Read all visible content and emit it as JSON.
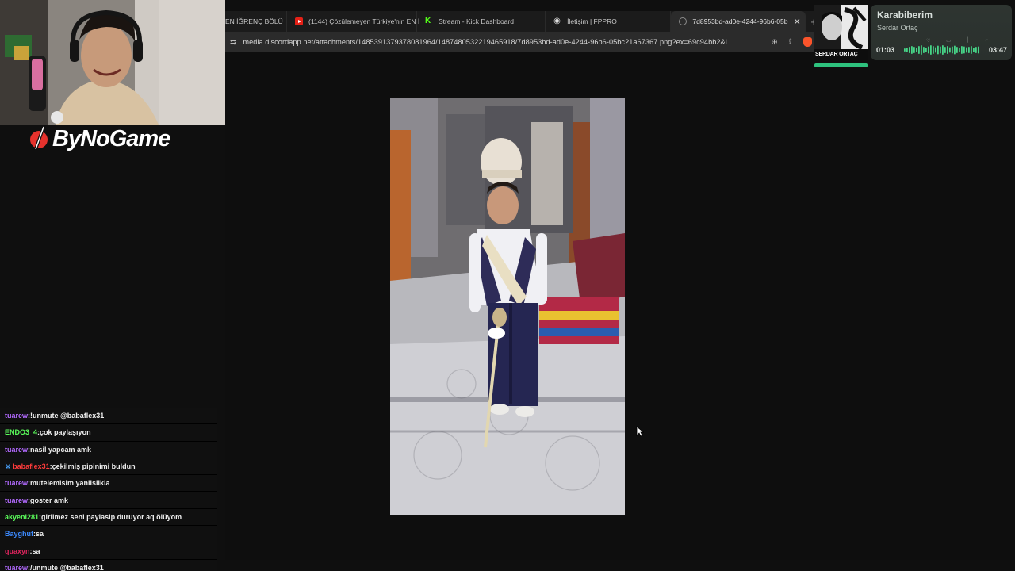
{
  "browser": {
    "tabs": [
      {
        "label": "EN İĞRENÇ BÖLÜ",
        "icon": "none",
        "active": false
      },
      {
        "label": "(1144) Çözülemeyen Türkiye'nin EN İ",
        "icon": "youtube-icon",
        "active": false
      },
      {
        "label": "Stream - Kick Dashboard",
        "icon": "kick-icon",
        "active": false
      },
      {
        "label": "İletişim | FPPRO",
        "icon": "discord-icon",
        "active": false
      },
      {
        "label": "7d8953bd-ad0e-4244-96b6-05b",
        "icon": "globe-icon",
        "active": true
      }
    ],
    "url": "media.discordapp.net/attachments/1485391379378081964/1487480532219465918/7d8953bd-ad0e-4244-96b6-05bc21a67367.png?ex=69c94bb2&i..."
  },
  "stream": {
    "brand": "ByNoGame"
  },
  "chat": [
    {
      "user": "tuarew",
      "color": "#b26aff",
      "text": "!unmute @babaflex31",
      "badge": false
    },
    {
      "user": "ENDO3_4",
      "color": "#5cff5c",
      "text": "çok paylaşıyon",
      "badge": false
    },
    {
      "user": "tuarew",
      "color": "#b26aff",
      "text": "nasil yapcam amk",
      "badge": false
    },
    {
      "user": "babaflex31",
      "color": "#ff3b3b",
      "text": "çekilmiş pipinimi buldun",
      "badge": true
    },
    {
      "user": "tuarew",
      "color": "#b26aff",
      "text": "mutelemisim yanlislikla",
      "badge": false
    },
    {
      "user": "tuarew",
      "color": "#b26aff",
      "text": "goster amk",
      "badge": false
    },
    {
      "user": "akyeni281",
      "color": "#5cff5c",
      "text": "girilmez seni paylasip duruyor aq ölüyom",
      "badge": false
    },
    {
      "user": "Bayghuf",
      "color": "#3d8bff",
      "text": "sa",
      "badge": false
    },
    {
      "user": "quaxyn",
      "color": "#e0245e",
      "text": "sa",
      "badge": false
    },
    {
      "user": "tuarew",
      "color": "#b26aff",
      "text": "/unmute @babaflex31",
      "badge": false
    }
  ],
  "player": {
    "title": "Karabiberim",
    "artist": "Serdar Ortaç",
    "current_time": "01:03",
    "total_time": "03:47",
    "album_text": "SERDAR ORTAÇ"
  },
  "colors": {
    "accent_green": "#2ec27e",
    "chat_bg": "#101010"
  }
}
